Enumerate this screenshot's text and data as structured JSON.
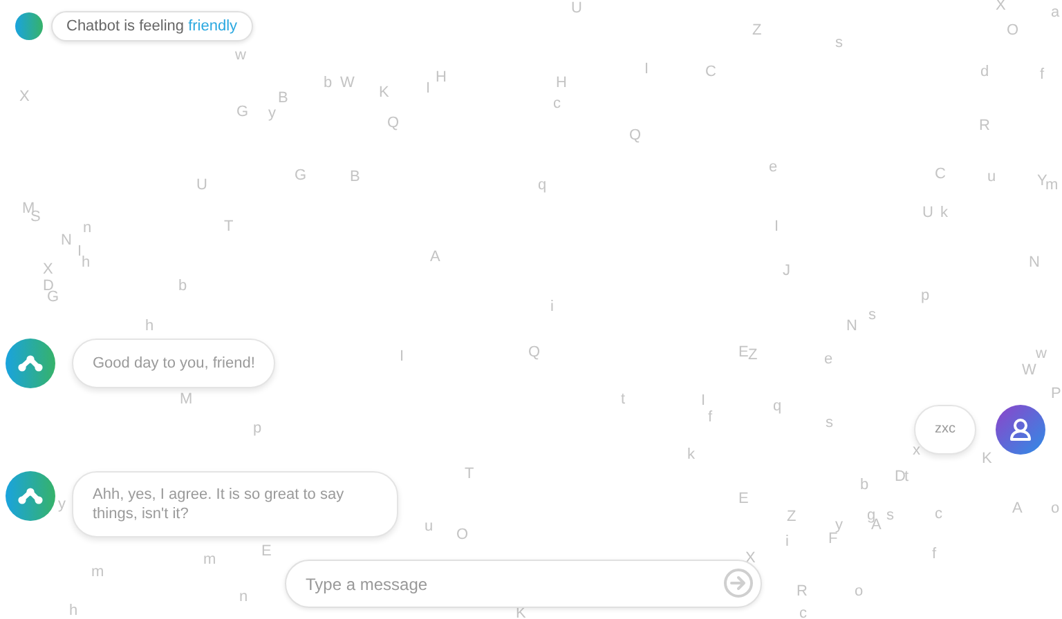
{
  "status": {
    "text": "Chatbot is feeling",
    "mood": "friendly"
  },
  "messages": [
    {
      "kind": "bot",
      "text": "Good day to you, friend!"
    },
    {
      "kind": "user",
      "text": "zxc"
    },
    {
      "kind": "bot",
      "text": "Ahh, yes, I agree. It is so great to say things, isn't it?"
    }
  ],
  "composer": {
    "placeholder": "Type a message"
  },
  "background_letters": [
    "U",
    "X",
    "a",
    "Z",
    "O",
    "s",
    "w",
    "d",
    "f",
    "I",
    "C",
    "b",
    "W",
    "K",
    "I",
    "H",
    "H",
    "c",
    "X",
    "G",
    "y",
    "B",
    "Q",
    "Q",
    "R",
    "G",
    "B",
    "e",
    "U",
    "q",
    "C",
    "u",
    "Y",
    "m",
    "M",
    "S",
    "n",
    "T",
    "U",
    "k",
    "I",
    "N",
    "I",
    "h",
    "A",
    "X",
    "N",
    "J",
    "D",
    "b",
    "G",
    "p",
    "i",
    "N",
    "s",
    "h",
    "I",
    "Q",
    "E",
    "Z",
    "e",
    "w",
    "W",
    "M",
    "P",
    "t",
    "I",
    "q",
    "f",
    "s",
    "p",
    "k",
    "x",
    "K",
    "T",
    "D",
    "t",
    "b",
    "y",
    "E",
    "u",
    "O",
    "Z",
    "g",
    "s",
    "y",
    "A",
    "c",
    "A",
    "o",
    "E",
    "i",
    "F",
    "m",
    "m",
    "X",
    "f",
    "n",
    "R",
    "o",
    "h",
    "K",
    "c"
  ]
}
